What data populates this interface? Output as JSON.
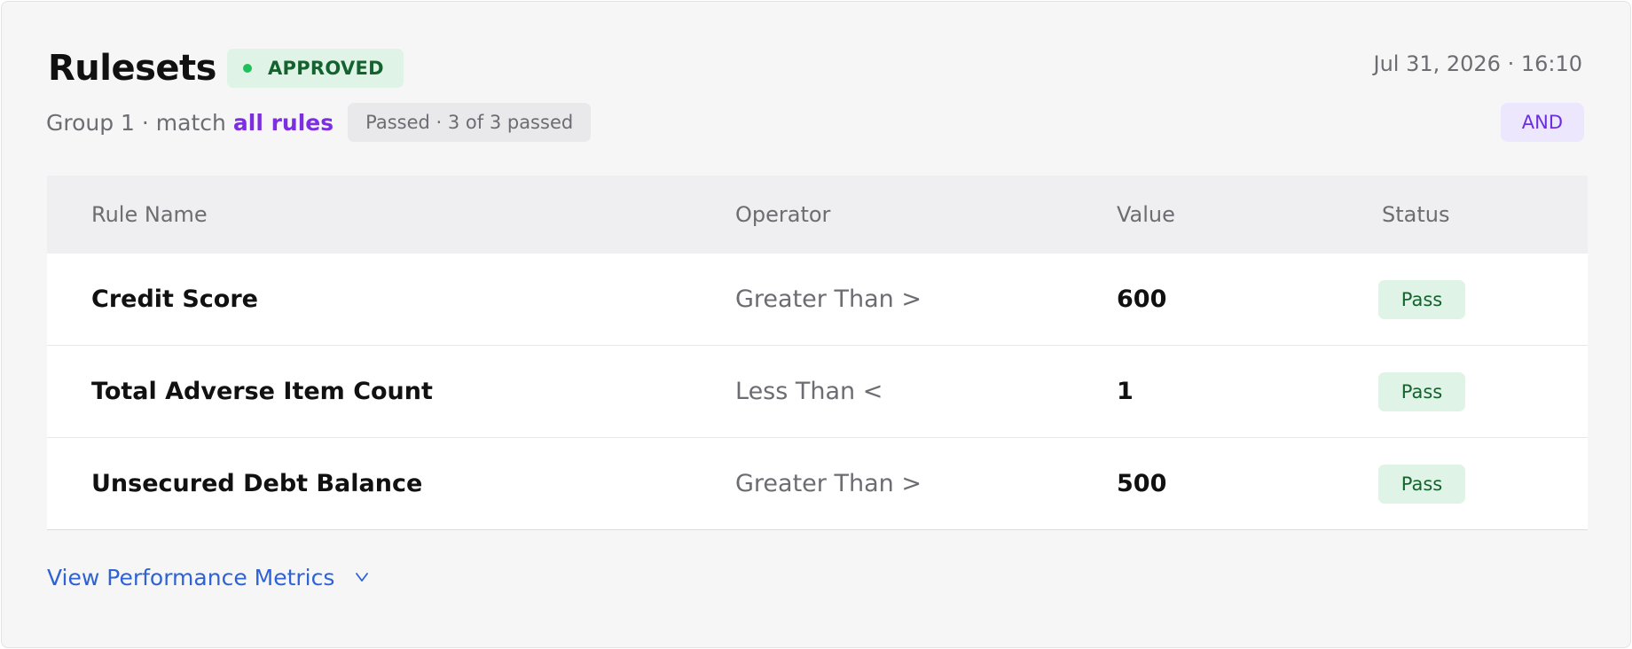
{
  "header": {
    "title": "Rulesets",
    "status_badge": "APPROVED",
    "timestamp": "Jul 31, 2026 · 16:10"
  },
  "group": {
    "label": "Group 1 · match",
    "match_mode": "all rules",
    "passed_summary": "Passed · 3 of 3 passed",
    "logic_chip": "AND"
  },
  "table": {
    "columns": {
      "name": "Rule Name",
      "operator": "Operator",
      "value": "Value",
      "status": "Status"
    },
    "rows": [
      {
        "name": "Credit Score",
        "operator": "Greater Than >",
        "value": "600",
        "status": "Pass"
      },
      {
        "name": "Total Adverse Item Count",
        "operator": "Less Than <",
        "value": "1",
        "status": "Pass"
      },
      {
        "name": "Unsecured Debt Balance",
        "operator": "Greater Than >",
        "value": "500",
        "status": "Pass"
      }
    ]
  },
  "footer": {
    "metrics_link": "View Performance Metrics",
    "metrics_icon": "chevron-down-icon"
  },
  "colors": {
    "accent_purple": "#7b2fe0",
    "link_blue": "#2f63d4",
    "success_green": "#14632f",
    "success_bg": "#dff3e6",
    "status_dot": "#1fc05c"
  }
}
